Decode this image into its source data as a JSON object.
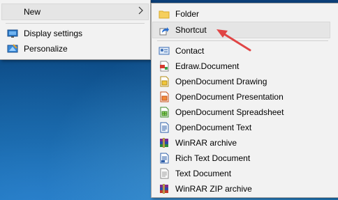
{
  "context_menu": {
    "items": [
      {
        "label": "New",
        "has_submenu": true
      },
      {
        "label": "Display settings",
        "icon": "display-settings-icon"
      },
      {
        "label": "Personalize",
        "icon": "personalize-icon"
      }
    ]
  },
  "new_submenu": {
    "items": [
      {
        "label": "Folder",
        "icon": "folder-icon"
      },
      {
        "label": "Shortcut",
        "icon": "shortcut-icon",
        "highlighted": true
      },
      {
        "label": "Contact",
        "icon": "contact-icon"
      },
      {
        "label": "Edraw.Document",
        "icon": "edraw-document-icon"
      },
      {
        "label": "OpenDocument Drawing",
        "icon": "odf-drawing-icon"
      },
      {
        "label": "OpenDocument Presentation",
        "icon": "odf-presentation-icon"
      },
      {
        "label": "OpenDocument Spreadsheet",
        "icon": "odf-spreadsheet-icon"
      },
      {
        "label": "OpenDocument Text",
        "icon": "odf-text-icon"
      },
      {
        "label": "WinRAR archive",
        "icon": "winrar-archive-icon"
      },
      {
        "label": "Rich Text Document",
        "icon": "rich-text-document-icon"
      },
      {
        "label": "Text Document",
        "icon": "text-document-icon"
      },
      {
        "label": "WinRAR ZIP archive",
        "icon": "winrar-zip-archive-icon"
      }
    ]
  },
  "colors": {
    "annotation_arrow": "#e04545",
    "highlight": "#e5e5e5",
    "menu_bg": "#f2f2f2"
  }
}
